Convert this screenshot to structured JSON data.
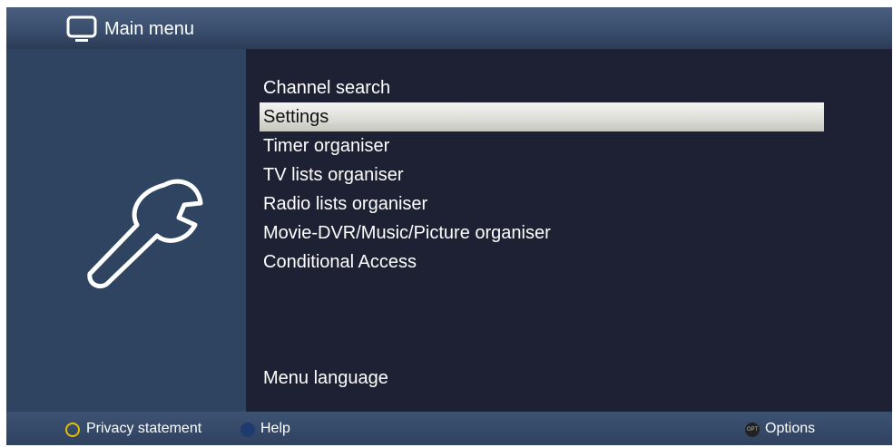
{
  "header": {
    "title": "Main menu",
    "icon": "tv-icon"
  },
  "side_icon": "wrench-icon",
  "menu": {
    "items": [
      {
        "label": "Channel search",
        "selected": false
      },
      {
        "label": "Settings",
        "selected": true
      },
      {
        "label": "Timer organiser",
        "selected": false
      },
      {
        "label": "TV lists organiser",
        "selected": false
      },
      {
        "label": "Radio lists organiser",
        "selected": false
      },
      {
        "label": "Movie-DVR/Music/Picture organiser",
        "selected": false
      },
      {
        "label": "Conditional Access",
        "selected": false
      }
    ],
    "bottom_item": {
      "label": "Menu language"
    }
  },
  "footer": {
    "privacy_label": "Privacy statement",
    "help_label": "Help",
    "options_label": "Options",
    "options_key_text": "OPT"
  },
  "colors": {
    "background": "#1d2133",
    "panel": "#2f4461",
    "header": "#3a4e6d",
    "highlight": "#dcdcd6",
    "yellow_key": "#e0c000",
    "blue_key": "#1f3a6e"
  }
}
